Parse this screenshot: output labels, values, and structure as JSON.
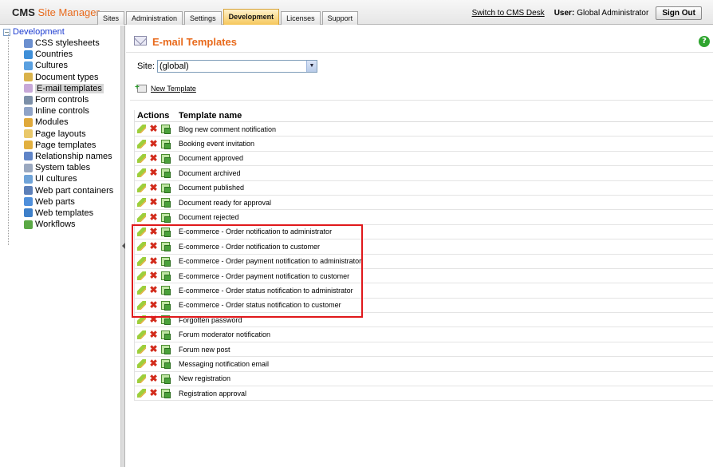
{
  "header": {
    "logo_cms": "CMS",
    "logo_site_manager": "Site Manager",
    "tabs": [
      "Sites",
      "Administration",
      "Settings",
      "Development",
      "Licenses",
      "Support"
    ],
    "active_tab": "Development",
    "switch_link": "Switch to CMS Desk",
    "user_label": "User:",
    "user_name": "Global Administrator",
    "sign_out": "Sign Out"
  },
  "tree": {
    "root": "Development",
    "root_expander": "−",
    "items": [
      {
        "label": "CSS stylesheets",
        "icon": "css-icon",
        "color": "#6b8fcf"
      },
      {
        "label": "Countries",
        "icon": "globe-icon",
        "color": "#3f8fd8"
      },
      {
        "label": "Cultures",
        "icon": "globe-icon",
        "color": "#5aa0e0"
      },
      {
        "label": "Document types",
        "icon": "document-type-icon",
        "color": "#d9b24a"
      },
      {
        "label": "E-mail templates",
        "icon": "email-icon",
        "color": "#c7a8d8"
      },
      {
        "label": "Form controls",
        "icon": "form-control-icon",
        "color": "#7c8fa8"
      },
      {
        "label": "Inline controls",
        "icon": "inline-control-icon",
        "color": "#8fa3c7"
      },
      {
        "label": "Modules",
        "icon": "modules-icon",
        "color": "#e0a93a"
      },
      {
        "label": "Page layouts",
        "icon": "page-layout-icon",
        "color": "#e9c86a"
      },
      {
        "label": "Page templates",
        "icon": "page-template-icon",
        "color": "#e2b03f"
      },
      {
        "label": "Relationship names",
        "icon": "relationship-icon",
        "color": "#5f84c7"
      },
      {
        "label": "System tables",
        "icon": "table-icon",
        "color": "#9aa8bf"
      },
      {
        "label": "UI cultures",
        "icon": "ui-culture-icon",
        "color": "#6fa3d8"
      },
      {
        "label": "Web part containers",
        "icon": "container-icon",
        "color": "#5c7fb8"
      },
      {
        "label": "Web parts",
        "icon": "web-parts-icon",
        "color": "#4f8fdb"
      },
      {
        "label": "Web templates",
        "icon": "web-template-icon",
        "color": "#3d7fc9"
      },
      {
        "label": "Workflows",
        "icon": "workflow-icon",
        "color": "#5aa845"
      }
    ],
    "selected": "E-mail templates"
  },
  "page": {
    "title": "E-mail Templates",
    "help": "?",
    "site_label": "Site:",
    "site_value": "(global)",
    "new_template": "New Template"
  },
  "grid": {
    "col_actions": "Actions",
    "col_name": "Template name",
    "rows": [
      "Blog new comment notification",
      "Booking event invitation",
      "Document approved",
      "Document archived",
      "Document published",
      "Document ready for approval",
      "Document rejected",
      "E-commerce - Order notification to administrator",
      "E-commerce - Order notification to customer",
      "E-commerce - Order payment notification to administrator",
      "E-commerce - Order payment notification to customer",
      "E-commerce - Order status notification to administrator",
      "E-commerce - Order status notification to customer",
      "Forgotten password",
      "Forum moderator notification",
      "Forum new post",
      "Messaging notification email",
      "New registration",
      "Registration approval"
    ]
  },
  "colors": {
    "accent": "#e86a1c",
    "highlight": "#e0181b",
    "link": "#1a3ad0"
  }
}
